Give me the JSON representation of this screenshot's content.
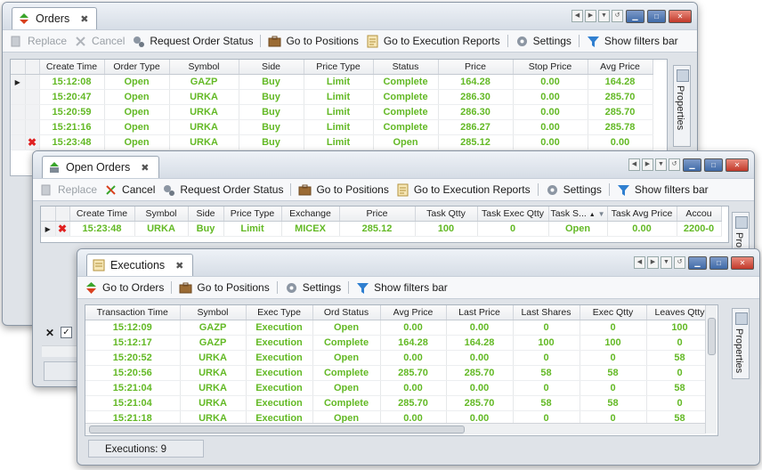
{
  "colors": {
    "value_green": "#63b925",
    "delete_red": "#e02020",
    "accent_blue": "#3f6aa8"
  },
  "orders": {
    "tab_title": "Orders",
    "toolbar": {
      "replace": "Replace",
      "cancel": "Cancel",
      "request_status": "Request Order Status",
      "go_positions": "Go to Positions",
      "go_exec_reports": "Go to Execution Reports",
      "settings": "Settings",
      "filters": "Show filters bar"
    },
    "columns": [
      "Create Time",
      "Order Type",
      "Symbol",
      "Side",
      "Price Type",
      "Status",
      "Price",
      "Stop Price",
      "Avg Price"
    ],
    "rows": [
      [
        "15:12:08",
        "Open",
        "GAZP",
        "Buy",
        "Limit",
        "Complete",
        "164.28",
        "0.00",
        "164.28"
      ],
      [
        "15:20:47",
        "Open",
        "URKA",
        "Buy",
        "Limit",
        "Complete",
        "286.30",
        "0.00",
        "285.70"
      ],
      [
        "15:20:59",
        "Open",
        "URKA",
        "Buy",
        "Limit",
        "Complete",
        "286.30",
        "0.00",
        "285.70"
      ],
      [
        "15:21:16",
        "Open",
        "URKA",
        "Buy",
        "Limit",
        "Complete",
        "286.27",
        "0.00",
        "285.78"
      ],
      [
        "15:23:48",
        "Open",
        "URKA",
        "Buy",
        "Limit",
        "Open",
        "285.12",
        "0.00",
        "0.00"
      ]
    ],
    "properties_label": "Properties"
  },
  "open_orders": {
    "tab_title": "Open Orders",
    "toolbar": {
      "replace": "Replace",
      "cancel": "Cancel",
      "request_status": "Request Order Status",
      "go_positions": "Go to Positions",
      "go_exec_reports": "Go to Execution Reports",
      "settings": "Settings",
      "filters": "Show filters bar"
    },
    "columns": [
      "Create Time",
      "Symbol",
      "Side",
      "Price Type",
      "Exchange",
      "Price",
      "Task Qtty",
      "Task Exec Qtty",
      "Task S...",
      "Task Avg Price",
      "Accou"
    ],
    "rows": [
      [
        "15:23:48",
        "URKA",
        "Buy",
        "Limit",
        "MICEX",
        "285.12",
        "100",
        "0",
        "Open",
        "0.00",
        "2200-0"
      ]
    ],
    "properties_label": "Prope"
  },
  "executions": {
    "tab_title": "Executions",
    "toolbar": {
      "go_orders": "Go to Orders",
      "go_positions": "Go to Positions",
      "settings": "Settings",
      "filters": "Show filters bar"
    },
    "columns": [
      "Transaction Time",
      "Symbol",
      "Exec Type",
      "Ord Status",
      "Avg Price",
      "Last Price",
      "Last Shares",
      "Exec Qtty",
      "Leaves Qtty"
    ],
    "rows": [
      [
        "15:12:09",
        "GAZP",
        "Execution",
        "Open",
        "0.00",
        "0.00",
        "0",
        "0",
        "100"
      ],
      [
        "15:12:17",
        "GAZP",
        "Execution",
        "Complete",
        "164.28",
        "164.28",
        "100",
        "100",
        "0"
      ],
      [
        "15:20:52",
        "URKA",
        "Execution",
        "Open",
        "0.00",
        "0.00",
        "0",
        "0",
        "58"
      ],
      [
        "15:20:56",
        "URKA",
        "Execution",
        "Complete",
        "285.70",
        "285.70",
        "58",
        "58",
        "0"
      ],
      [
        "15:21:04",
        "URKA",
        "Execution",
        "Open",
        "0.00",
        "0.00",
        "0",
        "0",
        "58"
      ],
      [
        "15:21:04",
        "URKA",
        "Execution",
        "Complete",
        "285.70",
        "285.70",
        "58",
        "58",
        "0"
      ],
      [
        "15:21:18",
        "URKA",
        "Execution",
        "Open",
        "0.00",
        "0.00",
        "0",
        "0",
        "58"
      ]
    ],
    "status_text": "Executions: 9",
    "properties_label": "Properties"
  }
}
